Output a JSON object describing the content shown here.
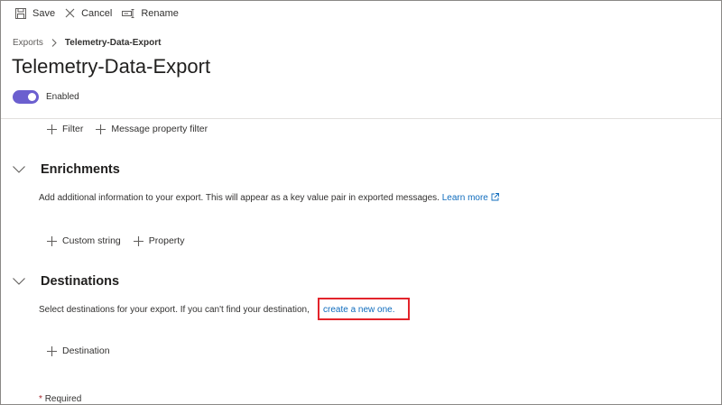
{
  "toolbar": {
    "save_label": "Save",
    "cancel_label": "Cancel",
    "rename_label": "Rename"
  },
  "breadcrumb": {
    "parent": "Exports",
    "current": "Telemetry-Data-Export"
  },
  "page": {
    "title": "Telemetry-Data-Export",
    "enabled_label": "Enabled",
    "enabled": true
  },
  "filters": {
    "filter_label": "Filter",
    "message_property_filter_label": "Message property filter"
  },
  "enrichments": {
    "title": "Enrichments",
    "description": "Add additional information to your export. This will appear as a key value pair in exported messages.",
    "learn_more": "Learn more",
    "custom_string_label": "Custom string",
    "property_label": "Property"
  },
  "destinations": {
    "title": "Destinations",
    "description": "Select destinations for your export. If you can't find your destination,",
    "create_link": "create a new one.",
    "destination_label": "Destination"
  },
  "footer": {
    "required_star": "*",
    "required_label": "Required"
  },
  "colors": {
    "accent": "#6b5fcf",
    "link": "#0f6cbd",
    "highlight": "#e3242b"
  }
}
